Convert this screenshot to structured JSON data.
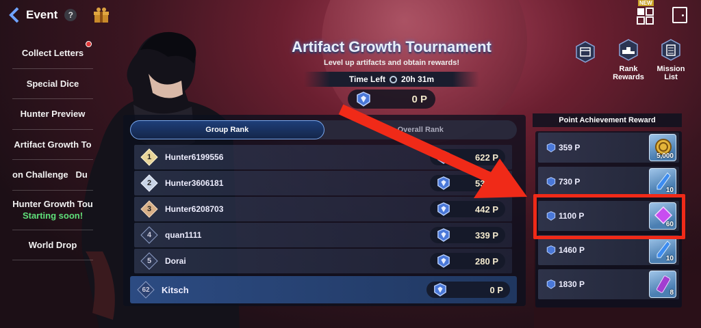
{
  "header": {
    "title": "Event",
    "help": "?"
  },
  "sidebar": {
    "items": [
      {
        "label": "Collect Letters",
        "badge": true
      },
      {
        "label": "Special Dice"
      },
      {
        "label": "Hunter Preview"
      },
      {
        "label": "Artifact Growth To"
      },
      {
        "label": "on Challenge   Du"
      },
      {
        "label": "Hunter Growth Tou",
        "sub": "Starting soon!"
      },
      {
        "label": "World Drop"
      }
    ]
  },
  "tournament": {
    "title": "Artifact Growth Tournament",
    "subtitle": "Level up artifacts and obtain rewards!",
    "time_label": "Time Left",
    "time_value": "20h 31m",
    "my_points": "0 P"
  },
  "right_menu": {
    "new_badge": "NEW",
    "rank_rewards": "Rank Rewards",
    "mission_list": "Mission List"
  },
  "rank_tabs": {
    "group": "Group Rank",
    "overall": "Overall Rank"
  },
  "rankings": [
    {
      "rank": "1",
      "name": "Hunter6199556",
      "score": "622 P"
    },
    {
      "rank": "2",
      "name": "Hunter3606181",
      "score": "530 P"
    },
    {
      "rank": "3",
      "name": "Hunter6208703",
      "score": "442 P"
    },
    {
      "rank": "4",
      "name": "quan1111",
      "score": "339 P"
    },
    {
      "rank": "5",
      "name": "Dorai",
      "score": "280 P"
    }
  ],
  "my_rank": {
    "rank": "62",
    "name": "Kitsch",
    "score": "0 P"
  },
  "rewards": {
    "header": "Point Achievement Reward",
    "items": [
      {
        "points": "359 P",
        "qty": "5,000",
        "item": "gold-coin-icon"
      },
      {
        "points": "730 P",
        "qty": "10",
        "item": "blue-crystal-icon"
      },
      {
        "points": "1100 P",
        "qty": "60",
        "item": "purple-gem-icon"
      },
      {
        "points": "1460 P",
        "qty": "10",
        "item": "blue-crystal-icon"
      },
      {
        "points": "1830 P",
        "qty": "8",
        "item": "purple-ticket-icon"
      }
    ]
  },
  "colors": {
    "accent": "#7aa9f0",
    "highlight": "#f02a18",
    "starting_soon": "#5fe07a"
  }
}
